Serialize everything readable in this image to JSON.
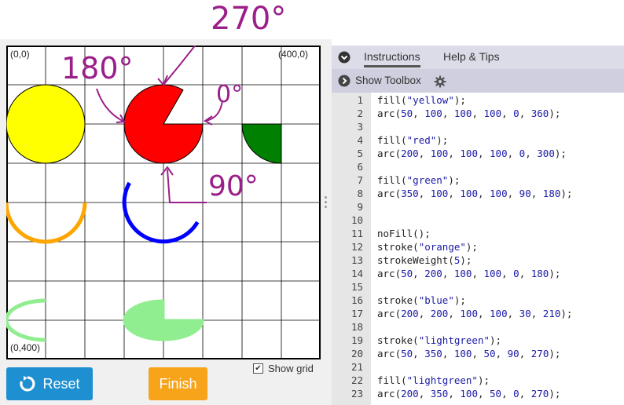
{
  "tabs": {
    "instructions": "Instructions",
    "help": "Help & Tips"
  },
  "toolbox": {
    "label": "Show Toolbox"
  },
  "canvas": {
    "label_top_left": "(0,0)",
    "label_top_right": "(400,0)",
    "label_bottom_left": "(0,400)"
  },
  "annotations": {
    "deg_270": "270°",
    "deg_180": "180°",
    "deg_0": "0°",
    "deg_90": "90°"
  },
  "buttons": {
    "reset": "Reset",
    "finish": "Finish"
  },
  "show_grid": {
    "label": "Show grid",
    "checked": true
  },
  "code_lines": [
    "fill(\"yellow\");",
    "arc(50, 100, 100, 100, 0, 360);",
    "",
    "fill(\"red\");",
    "arc(200, 100, 100, 100, 0, 300);",
    "",
    "fill(\"green\");",
    "arc(350, 100, 100, 100, 90, 180);",
    "",
    "",
    "noFill();",
    "stroke(\"orange\");",
    "strokeWeight(5);",
    "arc(50, 200, 100, 100, 0, 180);",
    "",
    "stroke(\"blue\");",
    "arc(200, 200, 100, 100, 30, 210);",
    "",
    "stroke(\"lightgreen\");",
    "arc(50, 350, 100, 50, 90, 270);",
    "",
    "fill(\"lightgreen\");",
    "arc(200, 350, 100, 50, 0, 270);"
  ],
  "line_numbers": [
    "1",
    "2",
    "3",
    "4",
    "5",
    "6",
    "7",
    "8",
    "9",
    "10",
    "11",
    "12",
    "13",
    "14",
    "15",
    "16",
    "17",
    "18",
    "19",
    "20",
    "21",
    "22",
    "23"
  ],
  "colors": {
    "accent_blue": "#1e8fd0",
    "accent_orange": "#f7a41b",
    "annotation_ink": "#9b1f8a"
  }
}
